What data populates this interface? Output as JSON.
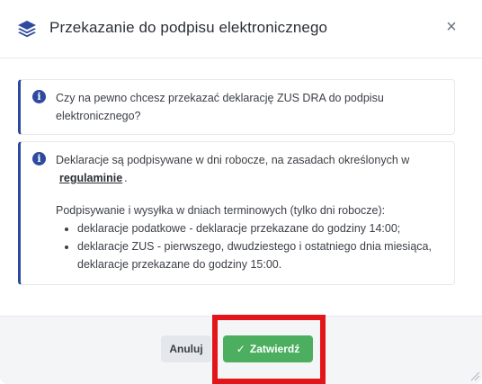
{
  "dialog": {
    "title": "Przekazanie do podpisu elektronicznego",
    "close_symbol": "×",
    "header_icon": "layers-icon",
    "accent_color": "#2e4a9e"
  },
  "body": {
    "info_1": {
      "text": "Czy na pewno chcesz przekazać deklarację ZUS DRA do podpisu elektronicznego?"
    },
    "info_2": {
      "intro": "Deklaracje są podpisywane w dni robocze, na zasadach określonych w",
      "link": "regulaminie",
      "intro_end": ".",
      "subheading": "Podpisywanie i wysyłka w dniach terminowych (tylko dni robocze):",
      "items": [
        "deklaracje podatkowe - deklaracje przekazane do godziny 14:00;",
        "deklaracje ZUS - pierwszego, dwudziestego i ostatniego dnia miesiąca, deklaracje przekazane do godziny 15:00."
      ]
    }
  },
  "footer": {
    "cancel_label": "Anuluj",
    "confirm_label": "Zatwierdź",
    "confirm_color": "#4caf5f",
    "highlight_color": "#e3151b"
  }
}
